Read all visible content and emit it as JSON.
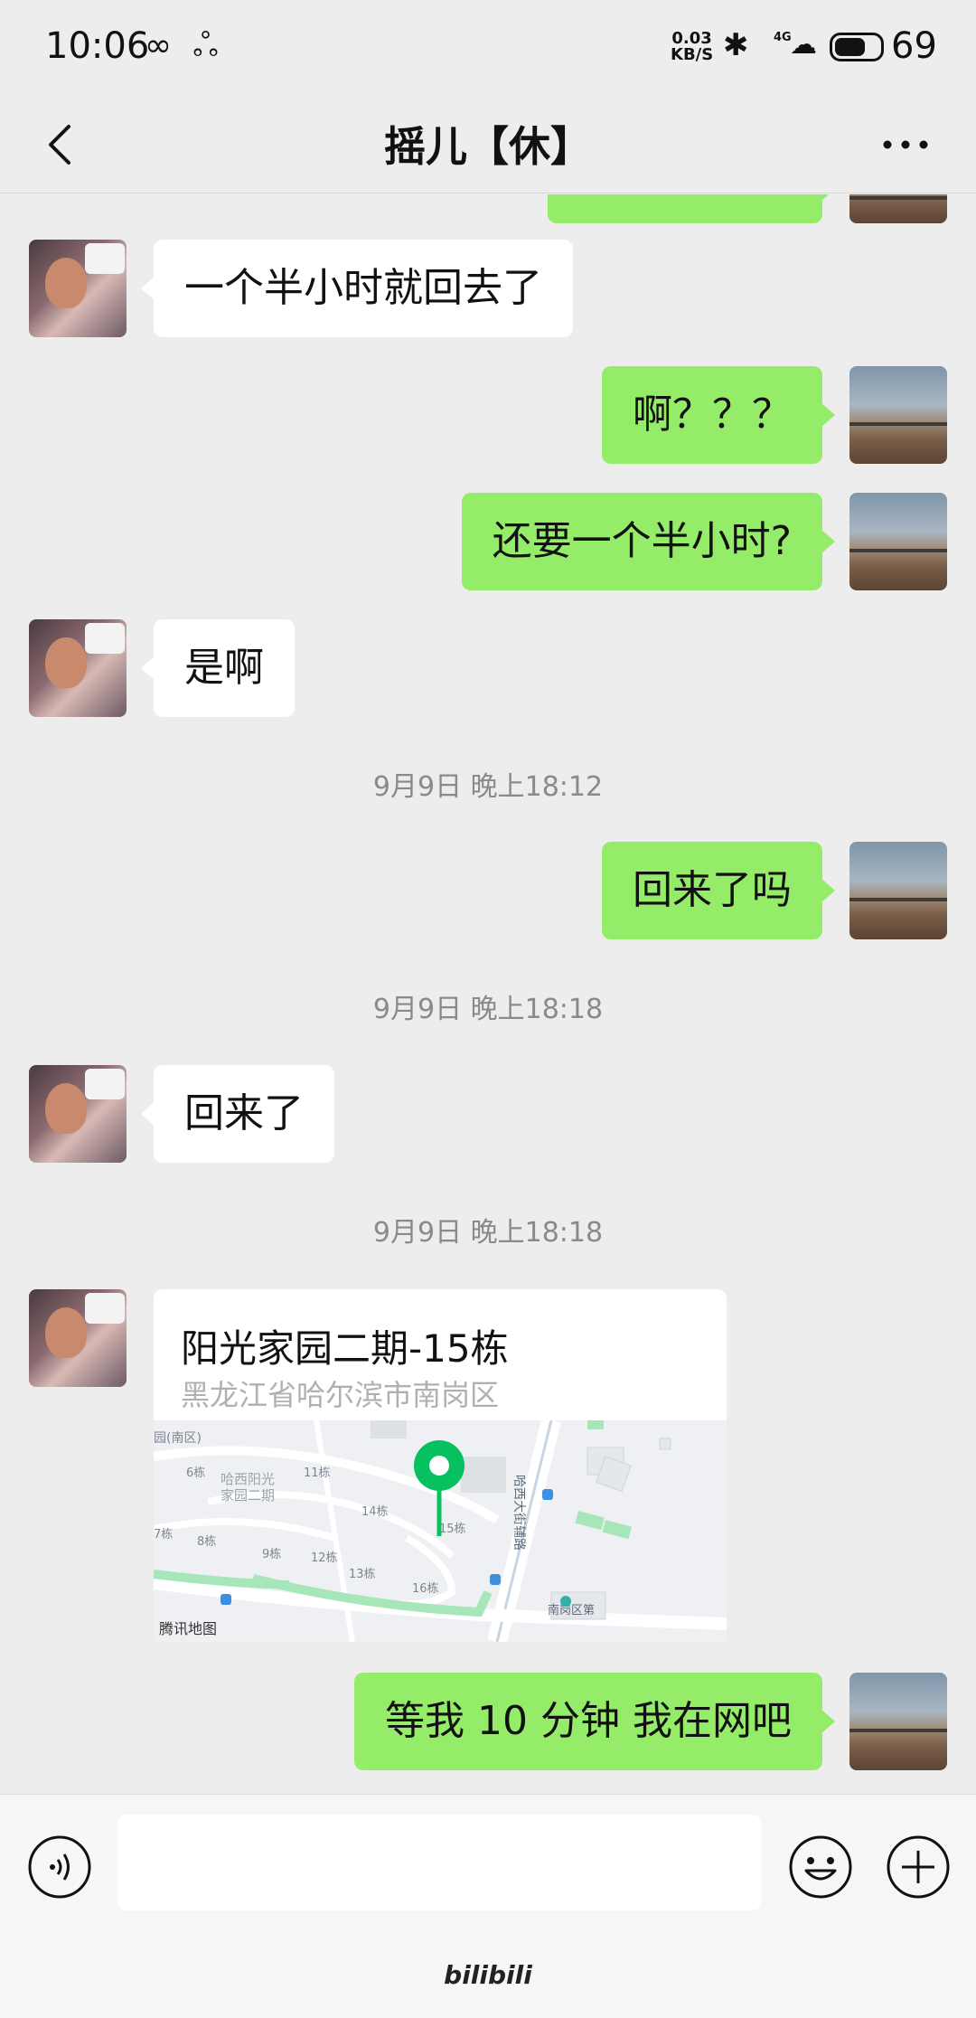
{
  "status_bar": {
    "time": "10:06",
    "left_icons": "∞ ஃ",
    "net_speed_value": "0.03",
    "net_speed_unit": "KB/S",
    "network": "4G",
    "battery_level": "69",
    "battery_fraction": 0.69
  },
  "header": {
    "title": "摇儿【休】"
  },
  "messages": [
    {
      "side": "in",
      "text": "一个半小时就回去了"
    },
    {
      "side": "out",
      "text": "啊？？？"
    },
    {
      "side": "out",
      "text": "还要一个半小时?"
    },
    {
      "side": "in",
      "text": "是啊"
    },
    {
      "side": "time",
      "text": "9月9日 晚上18:12"
    },
    {
      "side": "out",
      "text": "回来了吗"
    },
    {
      "side": "time",
      "text": "9月9日 晚上18:18"
    },
    {
      "side": "in",
      "text": "回来了"
    },
    {
      "side": "time",
      "text": "9月9日 晚上18:18"
    },
    {
      "side": "in-location",
      "text": "阳光家园二期-15栋"
    },
    {
      "side": "out",
      "text": "等我 10 分钟  我在网吧"
    }
  ],
  "location": {
    "title": "阳光家园二期-15栋",
    "address": "黑龙江省哈尔滨市南岗区",
    "map_attribution": "腾讯地图",
    "map_labels": [
      "哈西阳光家园二期",
      "哈西大街辅路",
      "南岗区第",
      "11栋",
      "14栋",
      "15栋",
      "16栋",
      "9栋",
      "12栋",
      "13栋",
      "8栋",
      "7栋",
      "6栋"
    ]
  },
  "input_bar": {
    "placeholder": ""
  },
  "watermark": "bilibili",
  "colors": {
    "outgoing_bubble": "#95ec69",
    "incoming_bubble": "#ffffff",
    "background": "#ededed",
    "pin": "#07c160"
  }
}
